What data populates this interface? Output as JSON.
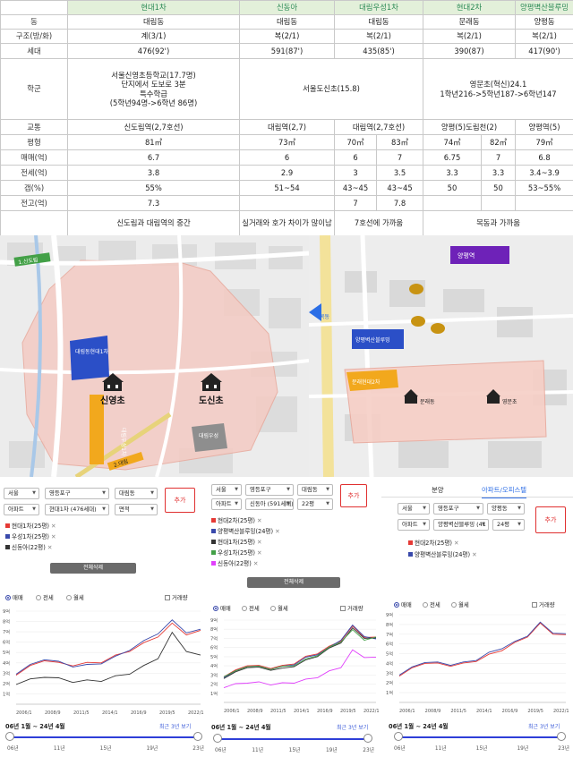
{
  "table": {
    "head": [
      "현대1차",
      "신동아",
      "대림우성1차",
      "현대2차",
      "양평벽산블루밍"
    ],
    "dong": {
      "label": "동",
      "values": [
        "대림동",
        "대림동",
        "대림동",
        "문래동",
        "양평동"
      ]
    },
    "structure": {
      "label": "구조(방/화)",
      "values": [
        "계(3/1)",
        "복(2/1)",
        "복(2/1)",
        "복(2/1)",
        "복(2/1)"
      ]
    },
    "households": {
      "label": "세대",
      "values": [
        "476(92')",
        "591(87')",
        "435(85')",
        "390(87)",
        "417(90')"
      ]
    },
    "school": {
      "label": "학군",
      "a": [
        "서울신영초등학교(17.7명)",
        "단지에서 도보로 3분",
        "특수학급",
        "(5학년94명->6학년 86명)"
      ],
      "b": "서울도신초(15.8)",
      "c": [
        "영문초(혁신)24.1",
        "1학년216->5학년187->6학년147"
      ]
    },
    "transit": {
      "label": "교통",
      "values": [
        "신도림역(2,7호선)",
        "대림역(2,7)",
        "대림역(2,7호선)",
        "양평(5)도림천(2)",
        "양평역(5)"
      ]
    },
    "area": {
      "label": "평형",
      "values": [
        "81㎡",
        "73㎡",
        "70㎡",
        "83㎡",
        "74㎡",
        "82㎡",
        "79㎡"
      ]
    },
    "sale": {
      "label": "매매(억)",
      "values": [
        "6.7",
        "6",
        "6",
        "7",
        "6.75",
        "7",
        "6.8"
      ]
    },
    "jeonse": {
      "label": "전세(억)",
      "values": [
        "3.8",
        "2.9",
        "3",
        "3.5",
        "3.3",
        "3.3",
        "3.4~3.9"
      ]
    },
    "gap": {
      "label": "갭(%)",
      "values": [
        "55%",
        "51~54",
        "43~45",
        "43~45",
        "50",
        "50",
        "53~55%"
      ]
    },
    "jeongo": {
      "label": "전고(억)",
      "values": [
        "7.3",
        "",
        "7",
        "7.8",
        "",
        "",
        ""
      ]
    },
    "notes": [
      "신도림과 대림역의 중간",
      "실거래와 호가 차이가 많이남",
      "7호선에 가까움",
      "목동과 가까움"
    ]
  },
  "map_left": {
    "road_label": "1.신도림",
    "apt1": "대림동현대1차",
    "apt2": "대림우성1차",
    "apt3": "대림우성",
    "school1": "신영초",
    "school2": "도신초",
    "station_label": "2.대림"
  },
  "map_right": {
    "top_label": "양평역",
    "apt_a": "양평벽산블루밍",
    "apt_b": "문래현대2차",
    "small": "목동",
    "school": "영문초",
    "school_small": "문래동"
  },
  "panels": [
    {
      "selects": [
        "서울",
        "영등포구",
        "대림동",
        "아파트",
        "현대1차 (476세대)",
        "면적"
      ],
      "add": "추가",
      "tags": [
        {
          "label": "현대1차(25평)",
          "color": "#e53935"
        },
        {
          "label": "우성1차(25평)",
          "color": "#3949ab"
        },
        {
          "label": "신동아(22평)",
          "color": "#333333"
        }
      ],
      "delete": "전체삭제"
    },
    {
      "selects": [
        "서울",
        "영등포구",
        "대림동",
        "아파트",
        "신동아 (591세대)",
        "22평"
      ],
      "add": "추가",
      "tags": [
        {
          "label": "현대2차(25평)",
          "color": "#e53935"
        },
        {
          "label": "양평벽산블루밍(24평)",
          "color": "#3949ab"
        },
        {
          "label": "현대1차(25평)",
          "color": "#333333"
        },
        {
          "label": "우성1차(25평)",
          "color": "#43a047"
        },
        {
          "label": "신동아(22평)",
          "color": "#e040fb"
        }
      ],
      "delete": "전체삭제"
    },
    {
      "tabs": [
        "분양",
        "아파트/오피스텔"
      ],
      "selects": [
        "서울",
        "영등포구",
        "양평동",
        "아파트",
        "양평벽산블루밍 (41",
        "24평"
      ],
      "add": "추가",
      "tags": [
        {
          "label": "현대2차(25평)",
          "color": "#e53935"
        },
        {
          "label": "양평벽산블루밍(24평)",
          "color": "#3949ab"
        }
      ]
    }
  ],
  "chart_controls": {
    "radios": [
      "매매",
      "전세",
      "월세"
    ],
    "checkbox": "거래량",
    "period": "06년 1월 ~ 24년 4월",
    "recent": "최근 3년 보기",
    "slider_ticks": [
      "06년",
      "11년",
      "15년",
      "19년",
      "23년"
    ]
  },
  "chart_data": [
    {
      "type": "line",
      "x": [
        "2006/1",
        "2008/9",
        "2011/5",
        "2014/1",
        "2016/9",
        "2019/5",
        "2022/1"
      ],
      "ylabels": [
        "1억",
        "2억",
        "3억",
        "4억",
        "5억",
        "6억",
        "7억",
        "8억",
        "9억"
      ],
      "ylim": [
        0,
        9
      ],
      "series": [
        {
          "color": "#e53935",
          "values": [
            2.9,
            3.6,
            4.3,
            3.9,
            3.8,
            3.9,
            4.1,
            4.6,
            5.2,
            5.8,
            6.6,
            7.7,
            6.8,
            7.0
          ]
        },
        {
          "color": "#3949ab",
          "values": [
            3.0,
            3.7,
            4.4,
            4.0,
            3.7,
            3.7,
            4.0,
            4.5,
            5.3,
            6.0,
            6.9,
            8.0,
            7.0,
            7.1
          ]
        },
        {
          "color": "#333333",
          "values": [
            2.0,
            2.3,
            2.7,
            2.4,
            2.2,
            2.2,
            2.3,
            2.6,
            3.0,
            3.6,
            4.5,
            6.8,
            5.2,
            4.6
          ]
        }
      ]
    },
    {
      "type": "line",
      "x": [
        "2006/1",
        "2008/9",
        "2011/5",
        "2014/1",
        "2016/9",
        "2019/5",
        "2022/1"
      ],
      "ylabels": [
        "1억",
        "2억",
        "3억",
        "4억",
        "5억",
        "6억",
        "7억",
        "8억",
        "9억"
      ],
      "ylim": [
        0,
        9
      ],
      "series": [
        {
          "color": "#e53935",
          "values": [
            2.9,
            3.4,
            4.1,
            3.9,
            3.8,
            3.9,
            4.3,
            4.9,
            5.4,
            6.0,
            6.8,
            8.2,
            7.2,
            7.0
          ]
        },
        {
          "color": "#3949ab",
          "values": [
            2.8,
            3.3,
            4.0,
            3.8,
            3.7,
            3.8,
            4.2,
            4.8,
            5.3,
            5.9,
            6.9,
            8.3,
            7.3,
            6.8
          ]
        },
        {
          "color": "#333333",
          "values": [
            2.7,
            3.2,
            3.9,
            3.7,
            3.6,
            3.6,
            4.0,
            4.5,
            5.1,
            5.8,
            6.6,
            8.0,
            7.1,
            6.9
          ]
        },
        {
          "color": "#43a047",
          "values": [
            2.9,
            3.3,
            4.0,
            3.8,
            3.7,
            3.8,
            4.1,
            4.6,
            5.2,
            5.9,
            6.7,
            7.8,
            6.9,
            7.0
          ]
        },
        {
          "color": "#e040fb",
          "values": [
            1.7,
            1.9,
            2.2,
            2.1,
            2.0,
            2.0,
            2.2,
            2.4,
            2.8,
            3.3,
            3.9,
            5.6,
            5.0,
            4.8
          ]
        }
      ]
    },
    {
      "type": "line",
      "x": [
        "2006/1",
        "2008/9",
        "2011/5",
        "2014/1",
        "2016/9",
        "2019/5",
        "2022/1"
      ],
      "ylabels": [
        "1억",
        "2억",
        "3억",
        "4억",
        "5억",
        "6억",
        "7억",
        "8억",
        "9억"
      ],
      "ylim": [
        0,
        9
      ],
      "series": [
        {
          "color": "#e53935",
          "values": [
            2.8,
            3.4,
            4.1,
            3.9,
            3.8,
            3.9,
            4.3,
            4.8,
            5.4,
            6.0,
            6.8,
            8.0,
            7.1,
            6.8
          ]
        },
        {
          "color": "#3949ab",
          "values": [
            2.9,
            3.5,
            4.2,
            4.0,
            3.9,
            4.0,
            4.4,
            5.0,
            5.6,
            6.1,
            6.9,
            8.1,
            7.2,
            6.9
          ]
        }
      ]
    }
  ]
}
